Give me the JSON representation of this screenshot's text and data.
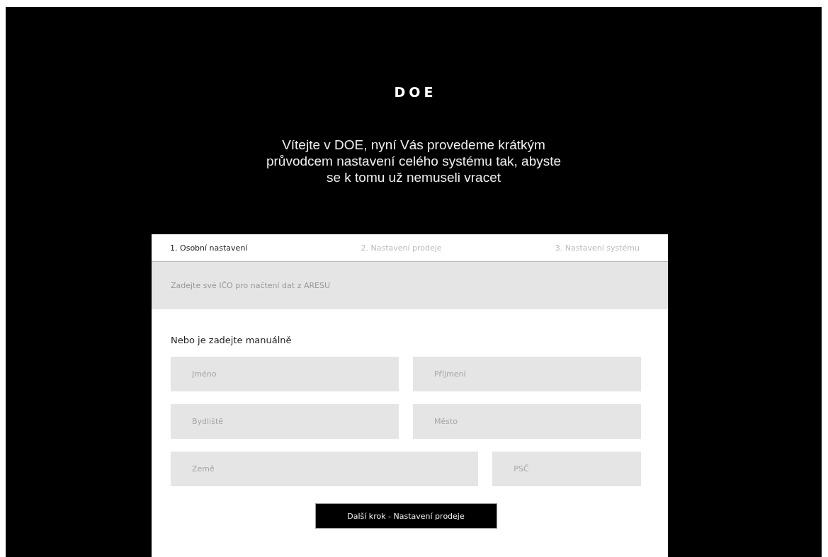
{
  "logo": "DOE",
  "intro": "Vítejte v DOE, nyní Vás provedeme krátkým průvodcem nastavení celého systému tak, abyste se k tomu už nemuseli vracet",
  "tabs": [
    {
      "label": "1. Osobní nastavení",
      "selected": true
    },
    {
      "label": "2. Nastavení prodeje",
      "selected": false
    },
    {
      "label": "3. Nastavení systému",
      "selected": false
    }
  ],
  "ico_field": {
    "placeholder": "Zadejte své IČO pro načtení dat z ARESU"
  },
  "manual_heading": "Nebo je zadejte manuálně",
  "field_rows": [
    [
      {
        "placeholder": "Jméno",
        "kind": "wide"
      },
      {
        "placeholder": "Příjmení",
        "kind": "wide"
      }
    ],
    [
      {
        "placeholder": "Bydliště",
        "kind": "wide"
      },
      {
        "placeholder": "Město",
        "kind": "wide"
      }
    ],
    [
      {
        "placeholder": "Země",
        "kind": "wide"
      },
      {
        "placeholder": "PSČ",
        "kind": "narrow"
      }
    ]
  ],
  "next_button": "Další krok - Nastavení prodeje"
}
